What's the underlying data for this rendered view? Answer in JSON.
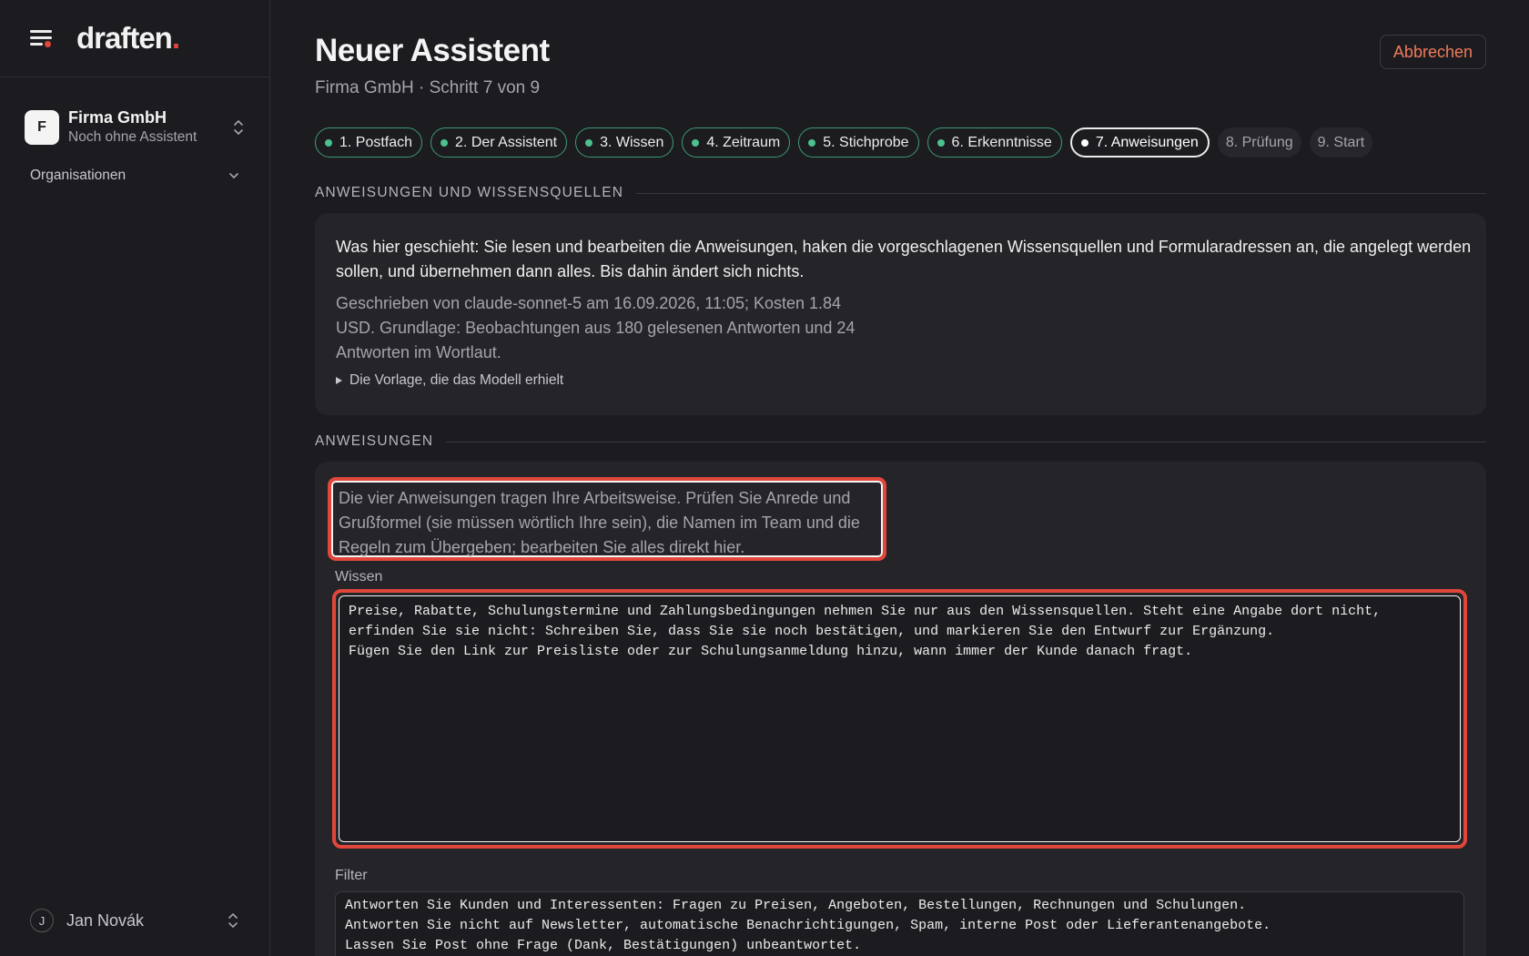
{
  "sidebar": {
    "logo_text": "draften",
    "logo_dot": ".",
    "org": {
      "initial": "F",
      "name": "Firma GmbH",
      "subtitle": "Noch ohne Assistent"
    },
    "organisations_label": "Organisationen",
    "user": {
      "initial": "J",
      "name": "Jan Novák"
    }
  },
  "header": {
    "title": "Neuer Assistent",
    "subtitle": "Firma GmbH · Schritt 7 von 9",
    "cancel_label": "Abbrechen"
  },
  "steps": [
    {
      "label": "1. Postfach",
      "state": "done"
    },
    {
      "label": "2. Der Assistent",
      "state": "done"
    },
    {
      "label": "3. Wissen",
      "state": "done"
    },
    {
      "label": "4. Zeitraum",
      "state": "done"
    },
    {
      "label": "5. Stichprobe",
      "state": "done"
    },
    {
      "label": "6. Erkenntnisse",
      "state": "done"
    },
    {
      "label": "7. Anweisungen",
      "state": "current"
    },
    {
      "label": "8. Prüfung",
      "state": "todo"
    },
    {
      "label": "9. Start",
      "state": "todo"
    }
  ],
  "info_section": {
    "heading": "ANWEISUNGEN UND WISSENSQUELLEN",
    "main_text": "Was hier geschieht: Sie lesen und bearbeiten die Anweisungen, haken die vorgeschlagenen Wissensquellen und Formularadressen an, die angelegt werden sollen, und übernehmen dann alles. Bis dahin ändert sich nichts.",
    "meta_text": "Geschrieben von claude-sonnet-5 am 16.09.2026, 11:05; Kosten 1.84 USD. Grundlage: Beobachtungen aus 180 gelesenen Antworten und 24 Antworten im Wortlaut.",
    "template_toggle": "Die Vorlage, die das Modell erhielt"
  },
  "instructions_section": {
    "heading": "ANWEISUNGEN",
    "intro": "Die vier Anweisungen tragen Ihre Arbeitsweise. Prüfen Sie Anrede und Grußformel (sie müssen wörtlich Ihre sein), die Namen im Team und die Regeln zum Übergeben; bearbeiten Sie alles direkt hier.",
    "wissen_label": "Wissen",
    "wissen_value": "Preise, Rabatte, Schulungstermine und Zahlungsbedingungen nehmen Sie nur aus den Wissensquellen. Steht eine Angabe dort nicht,\nerfinden Sie sie nicht: Schreiben Sie, dass Sie sie noch bestätigen, und markieren Sie den Entwurf zur Ergänzung.\nFügen Sie den Link zur Preisliste oder zur Schulungsanmeldung hinzu, wann immer der Kunde danach fragt.",
    "filter_label": "Filter",
    "filter_value": "Antworten Sie Kunden und Interessenten: Fragen zu Preisen, Angeboten, Bestellungen, Rechnungen und Schulungen.\nAntworten Sie nicht auf Newsletter, automatische Benachrichtigungen, Spam, interne Post oder Lieferantenangebote.\nLassen Sie Post ohne Frage (Dank, Bestätigungen) unbeantwortet."
  },
  "colors": {
    "accent_red": "#e0473a",
    "step_done": "#4cc08f",
    "cancel_text": "#f07a5a"
  },
  "icons": {
    "menu": "menu-icon",
    "org_switch": "chevron-up-down-icon",
    "organisations": "chevron-down-icon",
    "template": "triangle-right-icon"
  }
}
